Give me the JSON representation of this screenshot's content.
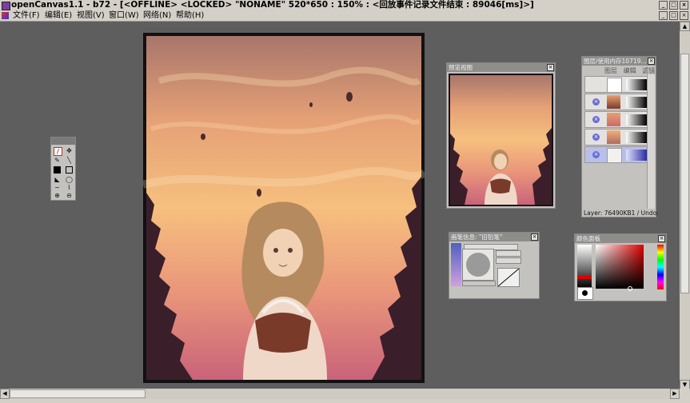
{
  "window": {
    "title": "openCanvas1.1 - b72 - [<OFFLINE> <LOCKED> \"NONAME\" 520*650 : 150% : <回放事件记录文件结束 : 89046[ms]>]",
    "controls": {
      "minimize": "_",
      "maximize": "□",
      "close": "×"
    }
  },
  "menu": [
    {
      "label": "文件(F)"
    },
    {
      "label": "编辑(E)"
    },
    {
      "label": "视图(V)"
    },
    {
      "label": "窗口(W)"
    },
    {
      "label": "网络(N)"
    },
    {
      "label": "帮助(H)"
    }
  ],
  "preview_panel": {
    "title": "预览视图",
    "close": "×"
  },
  "layer_panel": {
    "title": "图层/使用内存10719...",
    "tabs": [
      "图层",
      "编辑",
      "滤镜"
    ],
    "close": "×",
    "status": "Layer: 76490KB1 / Undo:"
  },
  "brush_panel": {
    "title": "画笔信息: \"旧铅笔\"",
    "close": "×"
  },
  "color_panel": {
    "title": "颜色面板",
    "close": "×"
  },
  "tools_panel": {
    "tools": [
      "pen-tool",
      "move-tool",
      "brush-tool",
      "line-tool",
      "fill-tool",
      "rect-tool",
      "bucket-tool",
      "lasso-tool",
      "curve-tool",
      "eraser-tool",
      "zoom-in-tool",
      "zoom-out-tool"
    ]
  },
  "colors": {
    "app_bg": "#5e5e5e",
    "chrome": "#d4d0c8",
    "panel_bg": "#c4c2bf",
    "panel_title": "#8f8d8a",
    "selected_layer": "#b8c0e8",
    "sky_top": "#b07a6a",
    "sky_mid": "#f0b27a",
    "silhouette": "#3a1f2a"
  }
}
